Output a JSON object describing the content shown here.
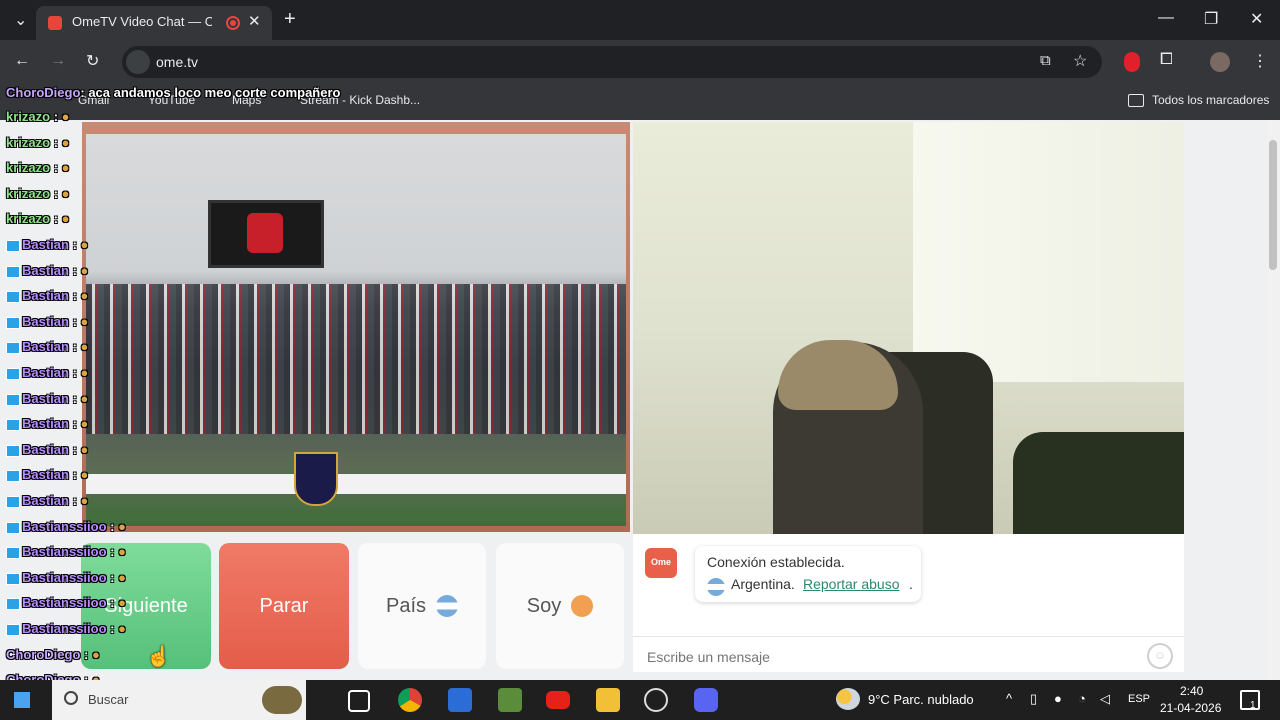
{
  "browser": {
    "tab_title": "OmeTV Video Chat — Ome",
    "tab_close": "✕",
    "new_tab": "+",
    "url": "ome.tv",
    "window_minimize": "—",
    "window_maximize": "❐",
    "window_close": "✕",
    "bookmarks": [
      {
        "label": "Gmail"
      },
      {
        "label": "YouTube"
      },
      {
        "label": "Maps"
      },
      {
        "label": "Stream - Kick Dashb..."
      }
    ],
    "all_bookmarks": "Todos los marcadores"
  },
  "chat_overlay": {
    "top_message": {
      "user": "ChoroDiego",
      "text": ": aca andamos loco meo corte compañero"
    },
    "lines": [
      {
        "user": "krizazo",
        "color": "green"
      },
      {
        "user": "krizazo",
        "color": "green"
      },
      {
        "user": "krizazo",
        "color": "green"
      },
      {
        "user": "krizazo",
        "color": "green"
      },
      {
        "user": "krizazo",
        "color": "green"
      },
      {
        "user": "Bastian",
        "color": "purple"
      },
      {
        "user": "Bastian",
        "color": "purple"
      },
      {
        "user": "Bastian",
        "color": "purple"
      },
      {
        "user": "Bastian",
        "color": "purple"
      },
      {
        "user": "Bastian",
        "color": "purple"
      },
      {
        "user": "Bastian",
        "color": "purple"
      },
      {
        "user": "Bastian",
        "color": "purple"
      },
      {
        "user": "Bastian",
        "color": "purple"
      },
      {
        "user": "Bastian",
        "color": "purple"
      },
      {
        "user": "Bastian",
        "color": "purple"
      },
      {
        "user": "Bastian",
        "color": "purple"
      },
      {
        "user": "Bastianssiioo",
        "color": "purple"
      },
      {
        "user": "Bastianssiioo",
        "color": "purple"
      },
      {
        "user": "Bastianssiioo",
        "color": "purple"
      },
      {
        "user": "Bastianssiioo",
        "color": "purple"
      },
      {
        "user": "Bastianssiioo",
        "color": "purple"
      },
      {
        "user": "ChoroDiego",
        "color": "choro"
      },
      {
        "user": "ChoroDiego",
        "color": "choro"
      },
      {
        "user": "ChoroDiego",
        "color": "choro"
      }
    ],
    "separator": " : "
  },
  "controls": {
    "next": "Siguiente",
    "stop": "Parar",
    "country": "País",
    "soy": "Soy"
  },
  "chat_panel": {
    "logo": "Ome TV",
    "status": "Conexión establecida.",
    "country": "Argentina.",
    "report": "Reportar abuso",
    "report_suffix": ".",
    "input_placeholder": "Escribe un mensaje",
    "emoji": "☺"
  },
  "taskbar": {
    "search": "Buscar",
    "weather": "9°C  Parc. nublado",
    "language": "ESP",
    "time": "2:40",
    "date": "21-04-2026",
    "notification_count": "1"
  },
  "colors": {
    "next_button": "#56c07a",
    "stop_button": "#e35d4a",
    "report_link": "#2a8a6e"
  }
}
